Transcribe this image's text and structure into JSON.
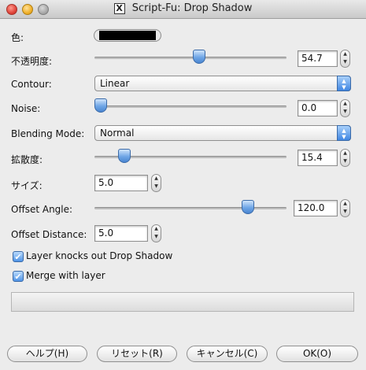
{
  "window": {
    "title": "Script-Fu: Drop Shadow",
    "app_icon_glyph": "X"
  },
  "fields": {
    "color": {
      "label": "色:",
      "value": "#000000"
    },
    "opacity": {
      "label": "不透明度:",
      "value": "54.7",
      "fraction": 0.547
    },
    "contour": {
      "label": "Contour:",
      "value": "Linear"
    },
    "noise": {
      "label": "Noise:",
      "value": "0.0",
      "fraction": 0.0
    },
    "blending_mode": {
      "label": "Blending Mode:",
      "value": "Normal"
    },
    "spread": {
      "label": "拡散度:",
      "value": "15.4",
      "fraction": 0.154
    },
    "size": {
      "label": "サイズ:",
      "value": "5.0"
    },
    "offset_angle": {
      "label": "Offset Angle:",
      "value": "120.0",
      "fraction": 0.8
    },
    "offset_distance": {
      "label": "Offset Distance:",
      "value": "5.0"
    }
  },
  "checks": {
    "knockout": {
      "label": "Layer knocks out Drop Shadow",
      "checked": true
    },
    "merge": {
      "label": "Merge with layer",
      "checked": true
    }
  },
  "buttons": {
    "help": "ヘルプ(H)",
    "reset": "リセット(R)",
    "cancel": "キャンセル(C)",
    "ok": "OK(O)"
  },
  "colors": {
    "accent": "#4b86d1",
    "window_bg": "#ececec"
  },
  "glyphs": {
    "up": "▲",
    "down": "▼",
    "check": "✔"
  }
}
